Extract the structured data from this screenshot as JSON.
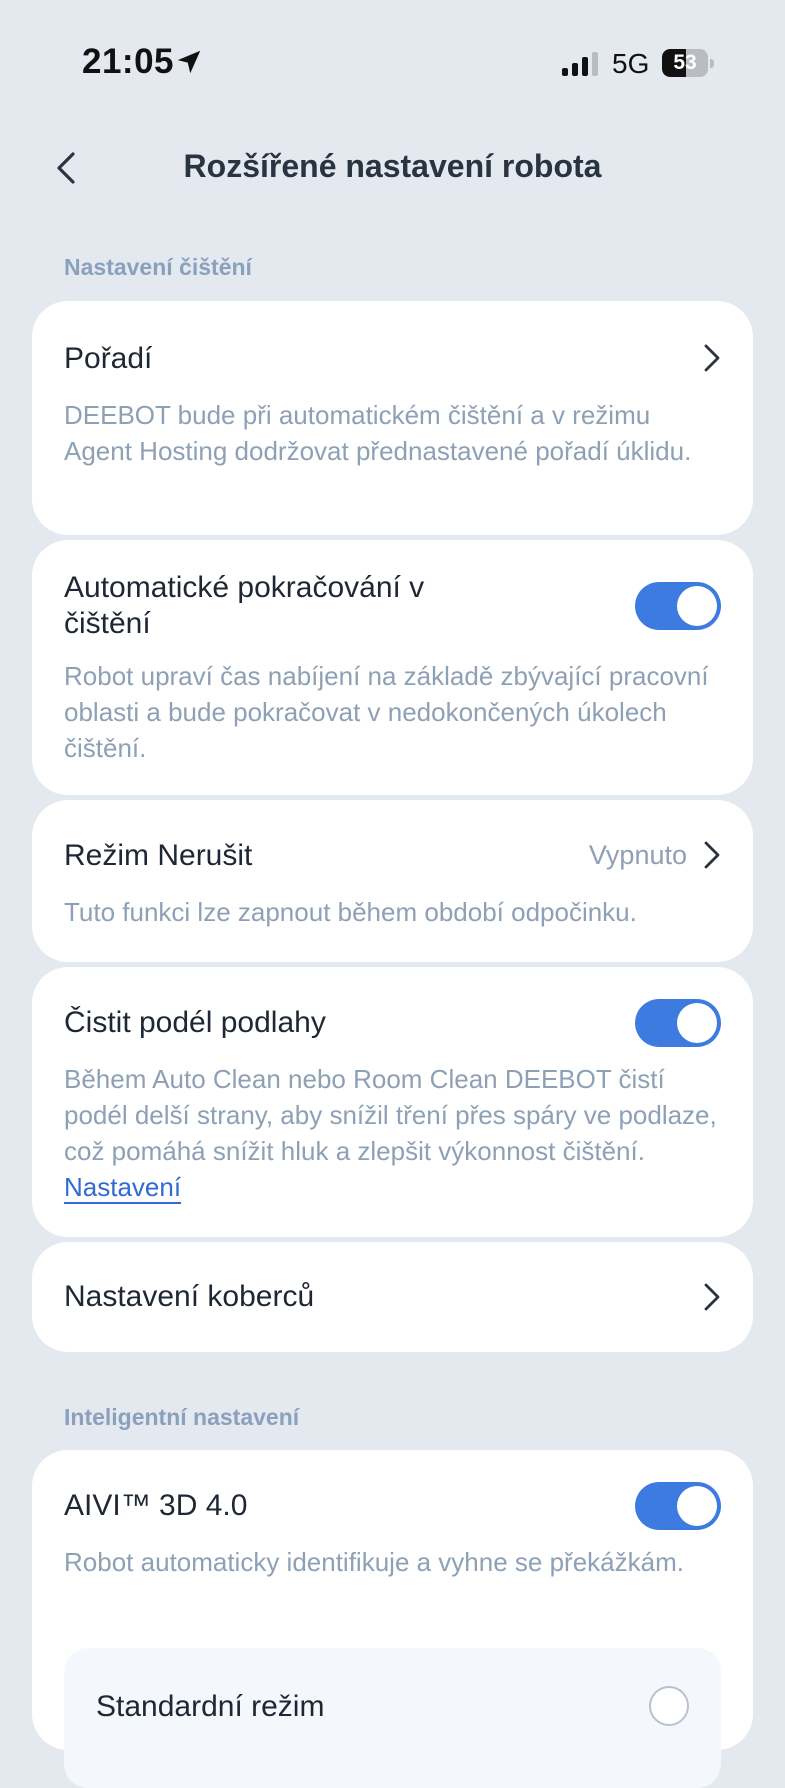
{
  "status_bar": {
    "time": "21:05",
    "network": "5G",
    "battery_percent": "53",
    "battery_level": 0.53
  },
  "header": {
    "title": "Rozšířené nastavení robota"
  },
  "sections": {
    "cleaning": {
      "title": "Nastavení čištění",
      "order": {
        "title": "Pořadí",
        "description": "DEEBOT bude při automatickém čištění a v režimu Agent Hosting dodržovat přednastavené pořadí úklidu."
      },
      "auto_resume": {
        "title": "Automatické pokračování v čištění",
        "enabled": true,
        "description": "Robot upraví čas nabíjení na základě zbývající pracovní oblasti a bude pokračovat v nedokončených úkolech čištění."
      },
      "dnd": {
        "title": "Režim Nerušit",
        "value": "Vypnuto",
        "description": "Tuto funkci lze zapnout během období odpočinku."
      },
      "floor_direction": {
        "title": "Čistit podél podlahy",
        "enabled": true,
        "description": "Během Auto Clean nebo Room Clean DEEBOT čistí podél delší strany, aby snížil tření přes spáry ve podlaze, což pomáhá snížit hluk a zlepšit výkonnost čištění.",
        "link_label": "Nastavení"
      },
      "carpet": {
        "title": "Nastavení koberců"
      }
    },
    "smart": {
      "title": "Inteligentní nastavení",
      "aivi": {
        "title": "AIVI™ 3D 4.0",
        "enabled": true,
        "description": "Robot automaticky identifikuje a vyhne se překážkám.",
        "mode_standard": "Standardní režim"
      }
    }
  },
  "colors": {
    "background": "#e4e9f0",
    "accent": "#3d7be0",
    "secondary_text": "#8ea0b6",
    "section_title": "#8aa0bd"
  }
}
